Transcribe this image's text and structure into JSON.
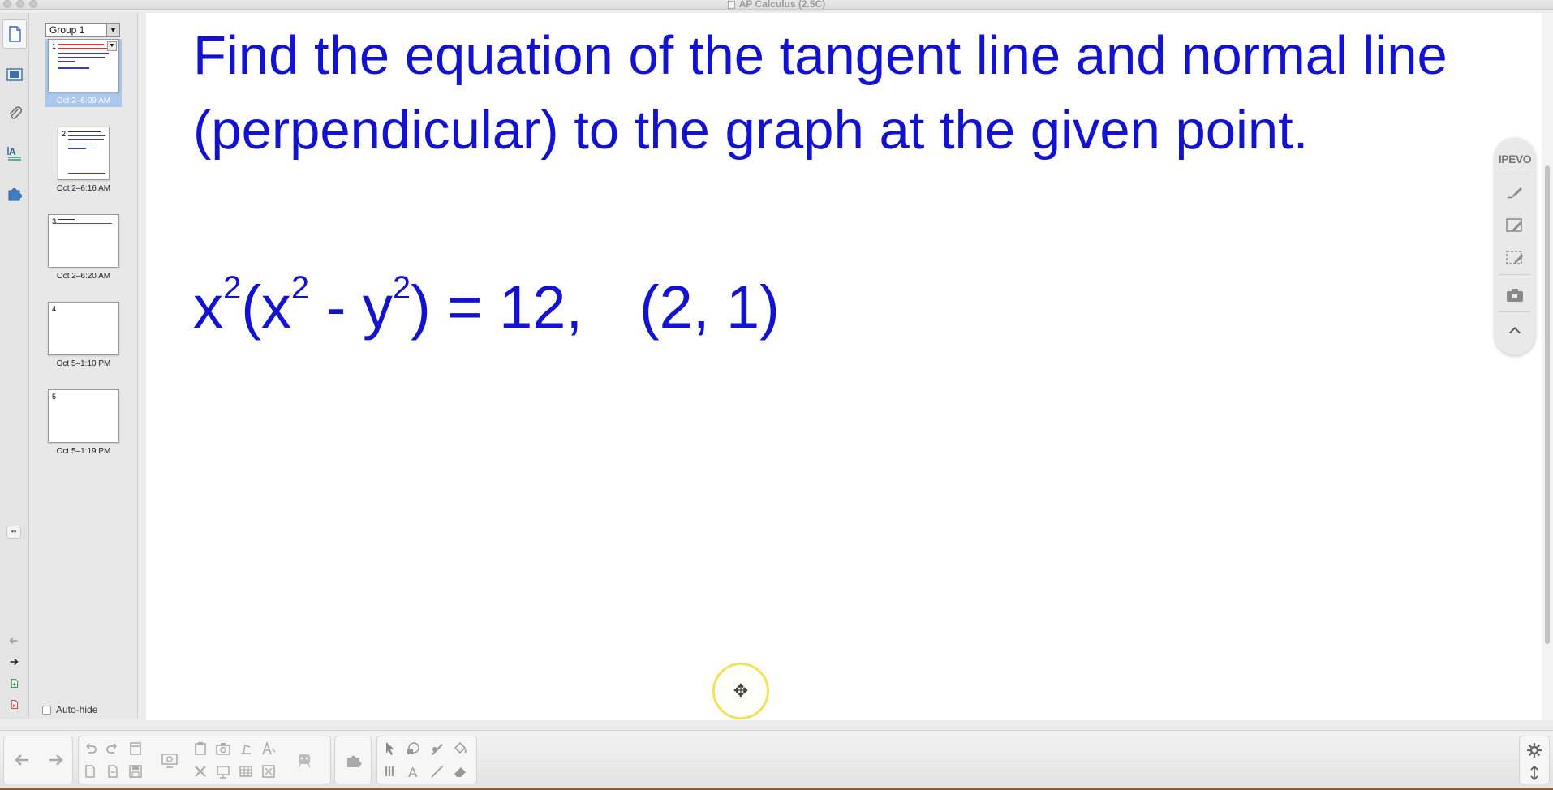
{
  "window": {
    "title": "AP Calculus (2.5C)"
  },
  "side_tabs": [
    "page-sorter-icon",
    "gallery-icon",
    "attachments-icon",
    "properties-icon",
    "add-ons-icon"
  ],
  "sorter": {
    "group": "Group 1",
    "pages": [
      {
        "number": "1",
        "date": "Oct 2–6:09 AM",
        "selected": true
      },
      {
        "number": "2",
        "date": "Oct 2–6:16 AM",
        "selected": false
      },
      {
        "number": "3",
        "date": "Oct 2–6:20 AM",
        "selected": false
      },
      {
        "number": "4",
        "date": "Oct 5–1:10 PM",
        "selected": false
      },
      {
        "number": "5",
        "date": "Oct 5–1:19 PM",
        "selected": false
      }
    ],
    "autohide_label": "Auto-hide"
  },
  "canvas": {
    "prompt": "Find the equation of the tangent line and normal line (perpendicular) to the graph at the given point.",
    "equation": {
      "x": "x",
      "exp": "2",
      "y": "y",
      "minus": " - ",
      "equals": ") = 12,",
      "point": "(2, 1)"
    }
  },
  "ipevo": {
    "brand": "IPEVO"
  },
  "colors": {
    "ink": "#1212cf",
    "selection": "#a9c8ec",
    "cursor_highlight": "#f2e15c"
  }
}
